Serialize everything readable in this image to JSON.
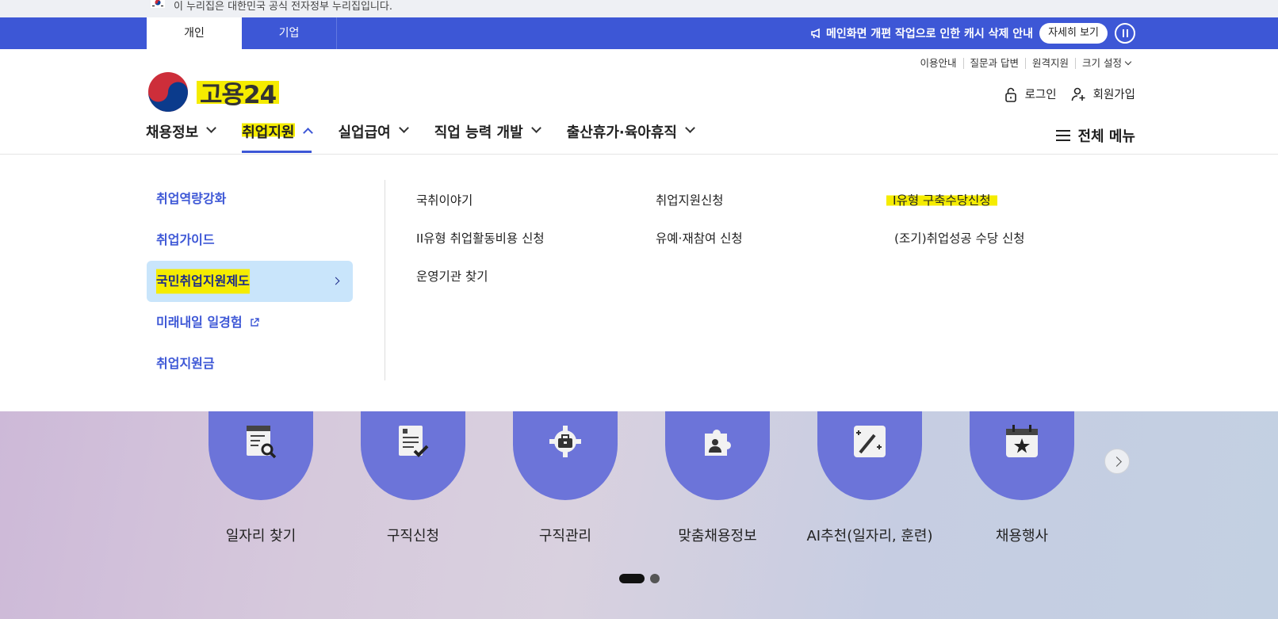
{
  "gov_banner": {
    "text": "이 누리집은 대한민국 공식 전자정부 누리집입니다."
  },
  "top_tabs": [
    {
      "label": "개인"
    },
    {
      "label": "기업"
    }
  ],
  "notice": {
    "text": "메인화면 개편 작업으로 인한 캐시 삭제 안내",
    "detail_label": "자세히 보기"
  },
  "util_links": [
    {
      "label": "이용안내"
    },
    {
      "label": "질문과 답변"
    },
    {
      "label": "원격지원"
    },
    {
      "label": "크기 설정"
    }
  ],
  "logo": {
    "text": "고용24"
  },
  "auth": {
    "login": "로그인",
    "signup": "회원가입"
  },
  "main_nav": [
    {
      "label": "채용정보"
    },
    {
      "label": "취업지원"
    },
    {
      "label": "실업급여"
    },
    {
      "label": "직업 능력 개발"
    },
    {
      "label": "출산휴가·육아휴직"
    }
  ],
  "all_menu": {
    "label": "전체 메뉴"
  },
  "submenu": [
    {
      "label": "취업역량강화"
    },
    {
      "label": "취업가이드"
    },
    {
      "label": "국민취업지원제도"
    },
    {
      "label": "미래내일 일경험"
    },
    {
      "label": "취업지원금"
    }
  ],
  "links": [
    {
      "label": "국취이야기"
    },
    {
      "label": "취업지원신청"
    },
    {
      "label": "I유형 구축수당신청"
    },
    {
      "label": "II유형 취업활동비용 신청"
    },
    {
      "label": "유예·재참여 신청"
    },
    {
      "label": "(조기)취업성공 수당 신청"
    },
    {
      "label": "운영기관 찾기"
    }
  ],
  "quick_menu": [
    {
      "label": "일자리 찾기",
      "icon": "document-search-icon"
    },
    {
      "label": "구직신청",
      "icon": "document-check-icon"
    },
    {
      "label": "구직관리",
      "icon": "gear-briefcase-icon"
    },
    {
      "label": "맞춤채용정보",
      "icon": "puzzle-person-icon"
    },
    {
      "label": "AI추천(일자리, 훈련)",
      "icon": "magic-wand-icon"
    },
    {
      "label": "채용행사",
      "icon": "calendar-star-icon"
    }
  ],
  "colors": {
    "primary": "#3d57d6",
    "highlight": "#f5ec00",
    "active_bg": "#c9e5fb",
    "quick_circle": "#6c74d9"
  }
}
